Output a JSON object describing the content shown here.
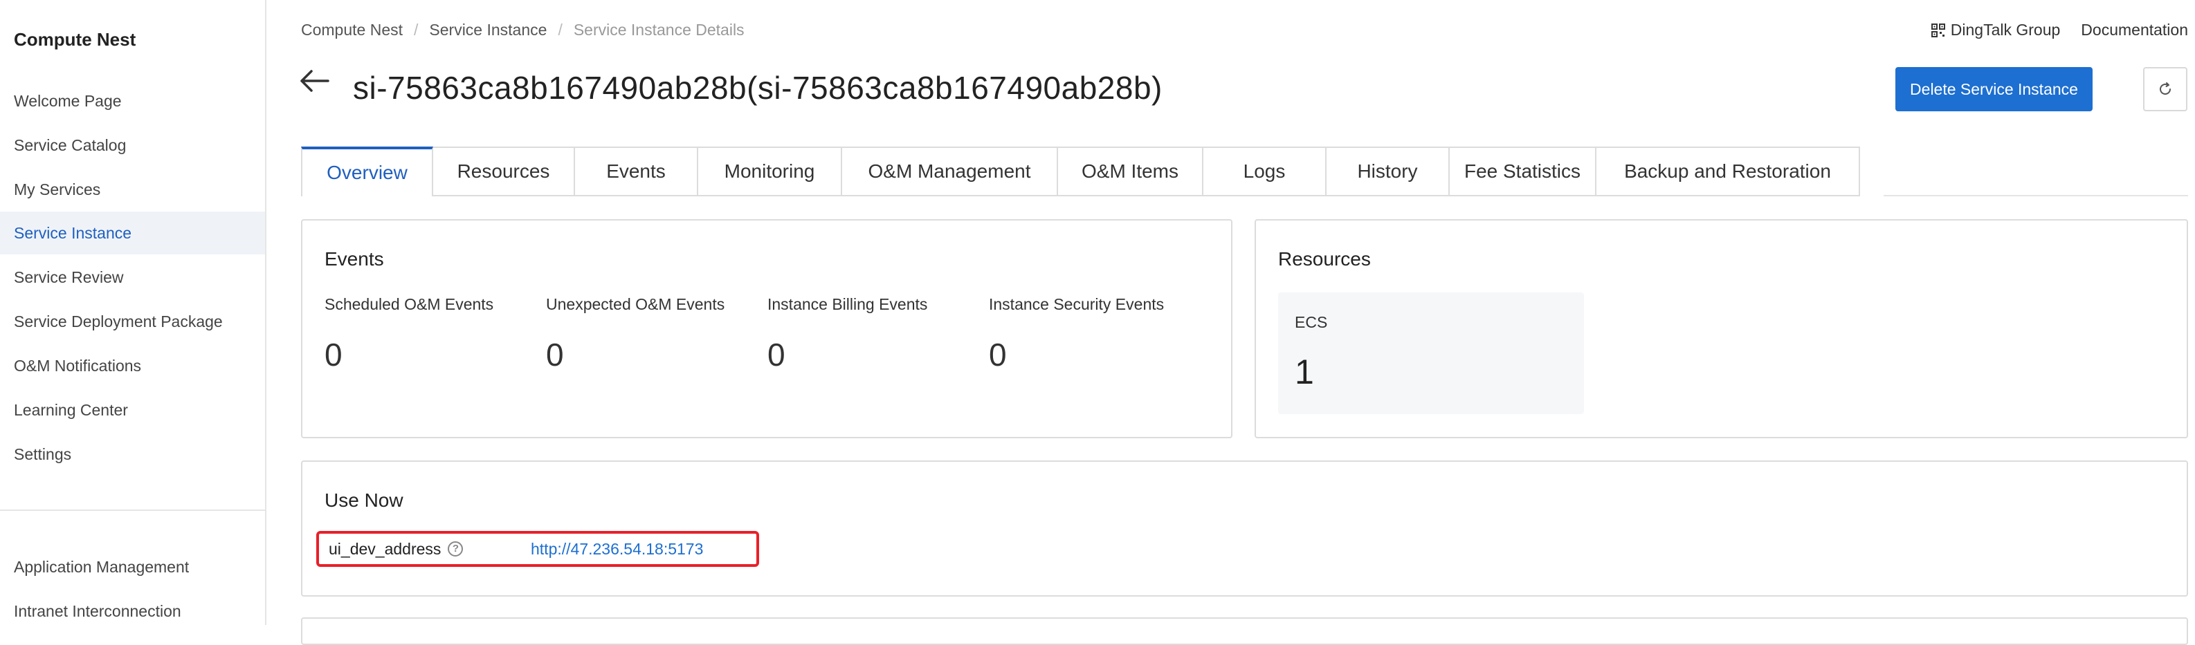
{
  "sidebar": {
    "brand": "Compute Nest",
    "items": [
      {
        "label": "Welcome Page"
      },
      {
        "label": "Service Catalog"
      },
      {
        "label": "My Services"
      },
      {
        "label": "Service Instance"
      },
      {
        "label": "Service Review"
      },
      {
        "label": "Service Deployment Package"
      },
      {
        "label": "O&M Notifications"
      },
      {
        "label": "Learning Center"
      },
      {
        "label": "Settings"
      }
    ],
    "bottom_items": [
      {
        "label": "Application Management"
      },
      {
        "label": "Intranet Interconnection"
      }
    ],
    "active_item": "Service Instance"
  },
  "breadcrumb": [
    "Compute Nest",
    "Service Instance",
    "Service Instance Details"
  ],
  "top_links": {
    "dingtalk": "DingTalk Group",
    "docs": "Documentation"
  },
  "header": {
    "title": "si-75863ca8b167490ab28b(si-75863ca8b167490ab28b)",
    "delete_button": "Delete Service Instance"
  },
  "tabs": [
    {
      "label": "Overview"
    },
    {
      "label": "Resources"
    },
    {
      "label": "Events"
    },
    {
      "label": "Monitoring"
    },
    {
      "label": "O&M Management"
    },
    {
      "label": "O&M Items"
    },
    {
      "label": "Logs"
    },
    {
      "label": "History"
    },
    {
      "label": "Fee Statistics"
    },
    {
      "label": "Backup and Restoration"
    }
  ],
  "active_tab": "Overview",
  "events_card": {
    "title": "Events",
    "items": [
      {
        "label": "Scheduled O&M Events",
        "value": "0"
      },
      {
        "label": "Unexpected O&M Events",
        "value": "0"
      },
      {
        "label": "Instance Billing Events",
        "value": "0"
      },
      {
        "label": "Instance Security Events",
        "value": "0"
      }
    ]
  },
  "resources_card": {
    "title": "Resources",
    "items": [
      {
        "label": "ECS",
        "value": "1"
      }
    ]
  },
  "use_now_card": {
    "title": "Use Now",
    "key": "ui_dev_address",
    "value": "http://47.236.54.18:5173"
  },
  "colors": {
    "accent": "#1d6fd1",
    "highlight_border": "#e8202a",
    "active_nav_bg": "#eff3f8"
  }
}
